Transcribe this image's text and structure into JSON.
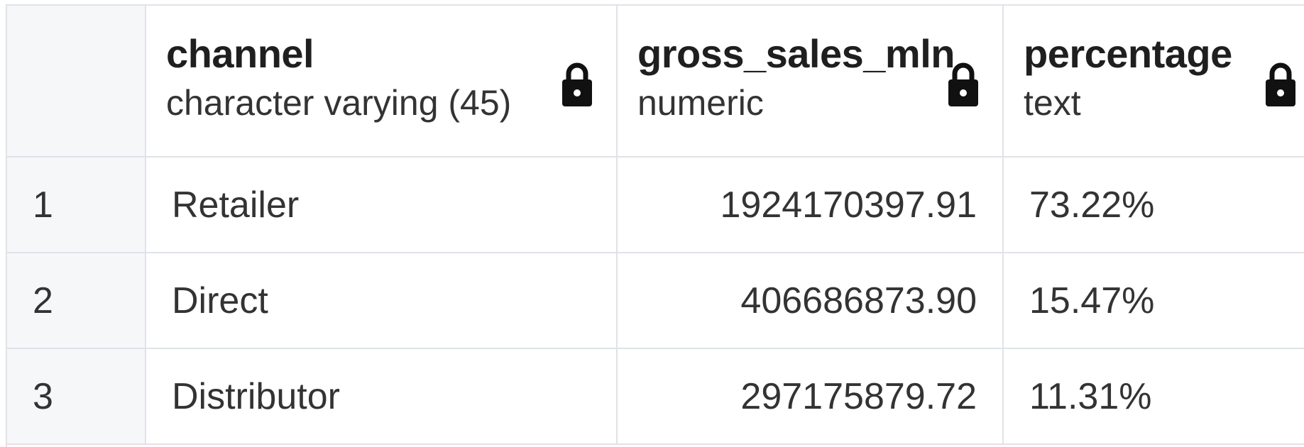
{
  "columns": [
    {
      "name": "channel",
      "type": "character varying (45)"
    },
    {
      "name": "gross_sales_mln",
      "type": "numeric"
    },
    {
      "name": "percentage",
      "type": "text"
    }
  ],
  "rows": [
    {
      "index": "1",
      "channel": "Retailer",
      "gross_sales_mln": "1924170397.91",
      "percentage": "73.22%"
    },
    {
      "index": "2",
      "channel": "Direct",
      "gross_sales_mln": "406686873.90",
      "percentage": "15.47%"
    },
    {
      "index": "3",
      "channel": "Distributor",
      "gross_sales_mln": "297175879.72",
      "percentage": "11.31%"
    }
  ],
  "icons": {
    "lock": "lock-icon"
  },
  "colors": {
    "border": "#dfe3e8",
    "header_bg": "#f6f7f9",
    "text": "#333333"
  }
}
